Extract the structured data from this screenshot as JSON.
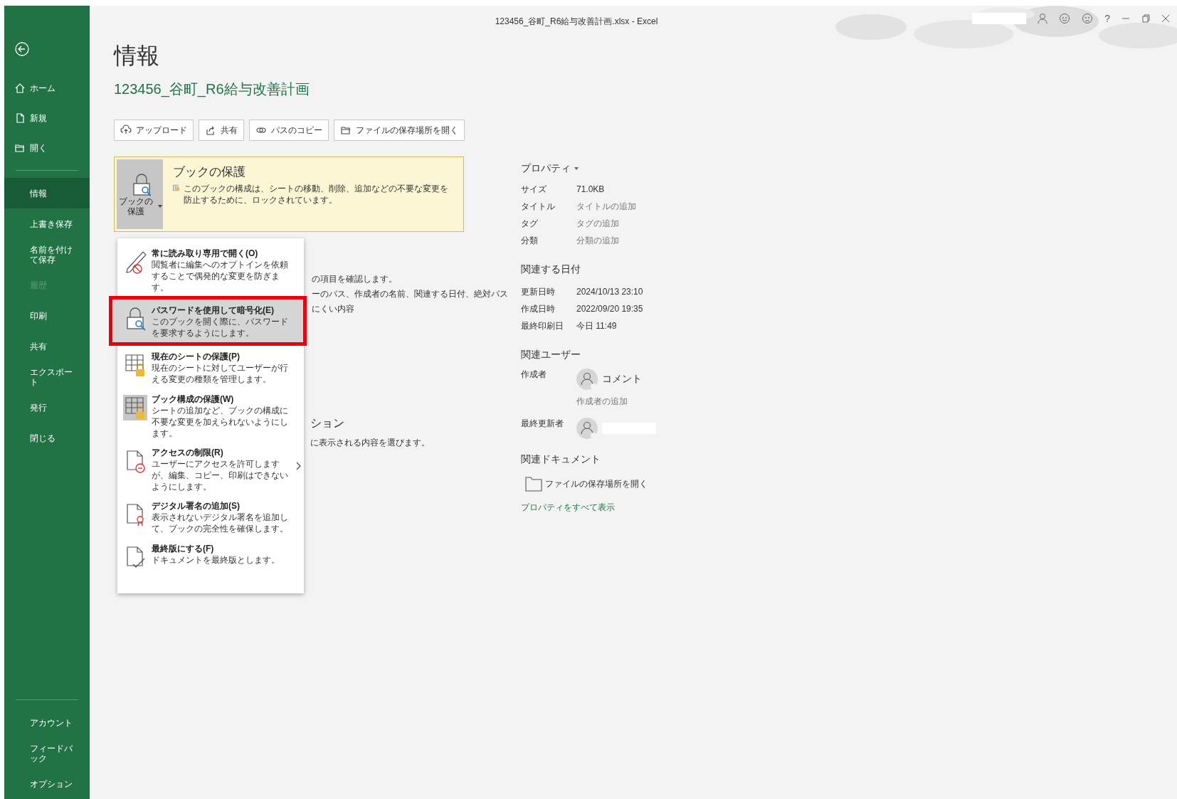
{
  "window": {
    "title": "123456_谷町_R6給与改善計画.xlsx - Excel",
    "help": "?"
  },
  "sidebar": {
    "top_items": [
      {
        "label": "ホーム",
        "kind": "home"
      },
      {
        "label": "新規",
        "kind": "new"
      },
      {
        "label": "開く",
        "kind": "open"
      }
    ],
    "items": [
      {
        "label": "情報",
        "selected": true,
        "disabled": false
      },
      {
        "label": "上書き保存",
        "selected": false,
        "disabled": false
      },
      {
        "label": "名前を付けて保存",
        "selected": false,
        "disabled": false
      },
      {
        "label": "履歴",
        "selected": false,
        "disabled": true
      },
      {
        "label": "印刷",
        "selected": false,
        "disabled": false
      },
      {
        "label": "共有",
        "selected": false,
        "disabled": false
      },
      {
        "label": "エクスポート",
        "selected": false,
        "disabled": false
      },
      {
        "label": "発行",
        "selected": false,
        "disabled": false
      },
      {
        "label": "閉じる",
        "selected": false,
        "disabled": false
      }
    ],
    "bottom_items": [
      {
        "label": "アカウント"
      },
      {
        "label": "フィードバック"
      },
      {
        "label": "オプション"
      }
    ]
  },
  "page": {
    "title": "情報",
    "file_name": "123456_谷町_R6給与改善計画",
    "actions": [
      {
        "label": "アップロード",
        "kind": "upload"
      },
      {
        "label": "共有",
        "kind": "share"
      },
      {
        "label": "パスのコピー",
        "kind": "link"
      },
      {
        "label": "ファイルの保存場所を開く",
        "kind": "folder"
      }
    ],
    "protection": {
      "button": "ブックの保護",
      "title": "ブックの保護",
      "description": "このブックの構成は、シートの移動、削除、追加などの不要な変更を防止するために、ロックされています。"
    },
    "inspect_lines": [
      "の項目を確認します。",
      "ーのパス、作成者の名前、関連する日付、絶対パス",
      "にくい内容"
    ],
    "browser_section": {
      "heading": "ション",
      "description": "に表示される内容を選びます。"
    }
  },
  "protect_menu": [
    {
      "title": "常に読み取り専用で開く(O)",
      "description": "閲覧者に編集へのオプトインを依頼することで偶発的な変更を防ぎます。",
      "kind": "pencil",
      "selected": false,
      "on": false,
      "submenu": false
    },
    {
      "title": "パスワードを使用して暗号化(E)",
      "description": "このブックを開く際に、パスワードを要求するようにします。",
      "kind": "lock",
      "selected": true,
      "on": false,
      "submenu": false
    },
    {
      "title": "現在のシートの保護(P)",
      "description": "現在のシートに対してユーザーが行える変更の種類を管理します。",
      "kind": "sheet",
      "selected": false,
      "on": false,
      "submenu": false
    },
    {
      "title": "ブック構成の保護(W)",
      "description": "シートの追加など、ブックの構成に不要な変更を加えられないようにします。",
      "kind": "sheet",
      "selected": false,
      "on": true,
      "submenu": false
    },
    {
      "title": "アクセスの制限(R)",
      "description": "ユーザーにアクセスを許可しますが、編集、コピー、印刷はできないようにします。",
      "kind": "restrict",
      "selected": false,
      "on": false,
      "submenu": true
    },
    {
      "title": "デジタル署名の追加(S)",
      "description": "表示されないデジタル署名を追加して、ブックの完全性を確保します。",
      "kind": "ribbon",
      "selected": false,
      "on": false,
      "submenu": false
    },
    {
      "title": "最終版にする(F)",
      "description": "ドキュメントを最終版とします。",
      "kind": "check",
      "selected": false,
      "on": false,
      "submenu": false
    }
  ],
  "properties": {
    "heading": "プロパティ",
    "rows": [
      {
        "label": "サイズ",
        "value": "71.0KB"
      },
      {
        "label": "タイトル",
        "placeholder": "タイトルの追加"
      },
      {
        "label": "タグ",
        "placeholder": "タグの追加"
      },
      {
        "label": "分類",
        "placeholder": "分類の追加"
      }
    ],
    "dates_heading": "関連する日付",
    "dates": [
      {
        "label": "更新日時",
        "value": "2024/10/13 23:10"
      },
      {
        "label": "作成日時",
        "value": "2022/09/20 19:35"
      },
      {
        "label": "最終印刷日",
        "value": "今日 11:49"
      }
    ],
    "people_heading": "関連ユーザー",
    "author_label": "作成者",
    "author_name": "コメント",
    "add_author": "作成者の追加",
    "modifier_label": "最終更新者",
    "docs_heading": "関連ドキュメント",
    "open_location": "ファイルの保存場所を開く",
    "show_all": "プロパティをすべて表示"
  }
}
